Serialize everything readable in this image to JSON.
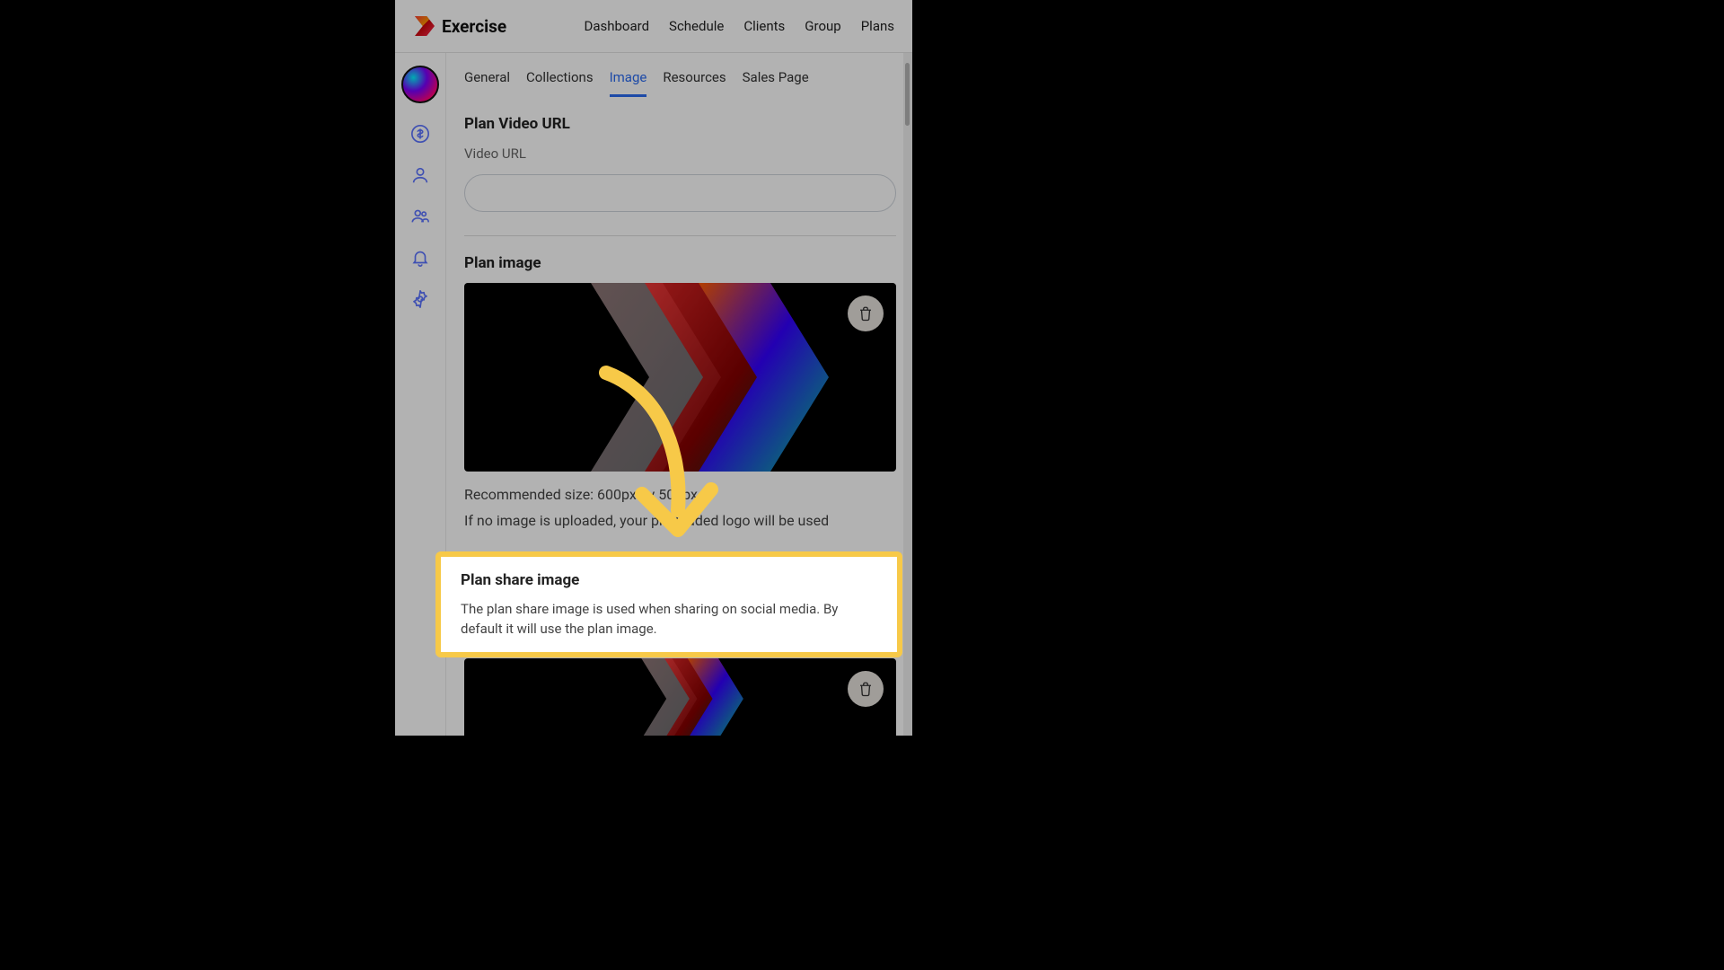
{
  "brand": {
    "name": "Exercise"
  },
  "nav": {
    "dashboard": "Dashboard",
    "schedule": "Schedule",
    "clients": "Clients",
    "group": "Group",
    "plans": "Plans"
  },
  "tabs": {
    "general": "General",
    "collections": "Collections",
    "image": "Image",
    "resources": "Resources",
    "sales": "Sales Page"
  },
  "sections": {
    "video": {
      "title": "Plan Video URL",
      "field_label": "Video URL",
      "value": ""
    },
    "plan_image": {
      "title": "Plan image",
      "helper_size": "Recommended size: 600px by 500px",
      "helper_fallback": "If no image is uploaded, your pre-loaded logo will be used"
    },
    "share_image": {
      "title": "Plan share image",
      "desc": "The plan share image is used when sharing on social media. By default it will use the plan image."
    }
  },
  "icons": {
    "billing": "dollar-circle-icon",
    "profile": "person-icon",
    "people": "people-icon",
    "notifications": "bell-icon",
    "settings": "gear-icon",
    "delete": "trash-icon"
  },
  "colors": {
    "accent": "#2a6af0",
    "highlight": "#f7c948"
  }
}
